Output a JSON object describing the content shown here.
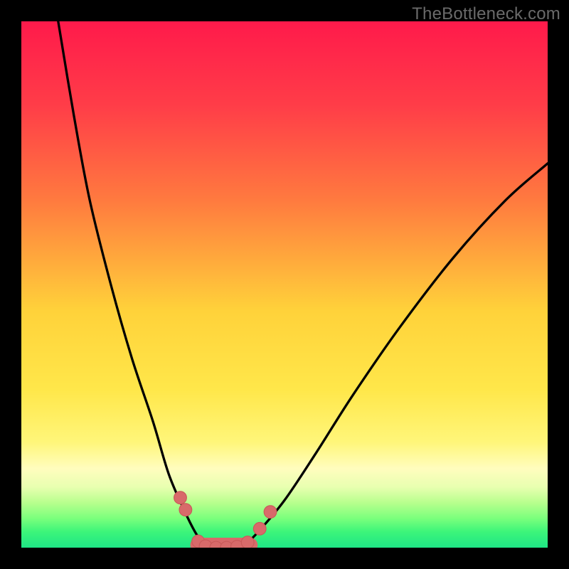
{
  "watermark": "TheBottleneck.com",
  "chart_data": {
    "type": "line",
    "title": "",
    "xlabel": "",
    "ylabel": "",
    "xlim": [
      0,
      100
    ],
    "ylim": [
      0,
      100
    ],
    "gradient_stops": [
      {
        "offset": 0.0,
        "color": "#ff1a4b"
      },
      {
        "offset": 0.16,
        "color": "#ff3d48"
      },
      {
        "offset": 0.34,
        "color": "#ff7a3f"
      },
      {
        "offset": 0.55,
        "color": "#ffd23a"
      },
      {
        "offset": 0.7,
        "color": "#ffe74a"
      },
      {
        "offset": 0.8,
        "color": "#fff67a"
      },
      {
        "offset": 0.85,
        "color": "#fffdbe"
      },
      {
        "offset": 0.885,
        "color": "#e8ffb0"
      },
      {
        "offset": 0.915,
        "color": "#b7ff8d"
      },
      {
        "offset": 0.945,
        "color": "#79ff7c"
      },
      {
        "offset": 0.97,
        "color": "#3cf57a"
      },
      {
        "offset": 1.0,
        "color": "#1fe585"
      }
    ],
    "series": [
      {
        "name": "left-curve",
        "x": [
          7,
          10,
          13,
          17,
          21,
          25,
          28,
          31,
          33,
          35
        ],
        "y": [
          100,
          82,
          66,
          50,
          36,
          24,
          14,
          7,
          3,
          0
        ]
      },
      {
        "name": "right-curve",
        "x": [
          42,
          45,
          50,
          56,
          63,
          72,
          82,
          92,
          100
        ],
        "y": [
          0,
          3,
          9,
          18,
          29,
          42,
          55,
          66,
          73
        ]
      }
    ],
    "markers": [
      {
        "x": 30.2,
        "y": 9.5,
        "r": 1.2
      },
      {
        "x": 31.2,
        "y": 7.2,
        "r": 1.2
      },
      {
        "x": 33.6,
        "y": 1.2,
        "r": 1.2
      },
      {
        "x": 35.0,
        "y": 0.3,
        "r": 1.2
      },
      {
        "x": 37.0,
        "y": 0.0,
        "r": 1.2
      },
      {
        "x": 39.0,
        "y": 0.0,
        "r": 1.2
      },
      {
        "x": 41.0,
        "y": 0.2,
        "r": 1.2
      },
      {
        "x": 43.0,
        "y": 1.0,
        "r": 1.2
      },
      {
        "x": 45.3,
        "y": 3.6,
        "r": 1.2
      },
      {
        "x": 47.3,
        "y": 6.8,
        "r": 1.2
      }
    ],
    "marker_color": "#d86a6a",
    "marker_stroke": "#c95959",
    "valley_band": {
      "x0": 33.5,
      "x1": 43.5,
      "y": 0.5,
      "thickness": 2.8,
      "color": "#d86a6a"
    }
  }
}
